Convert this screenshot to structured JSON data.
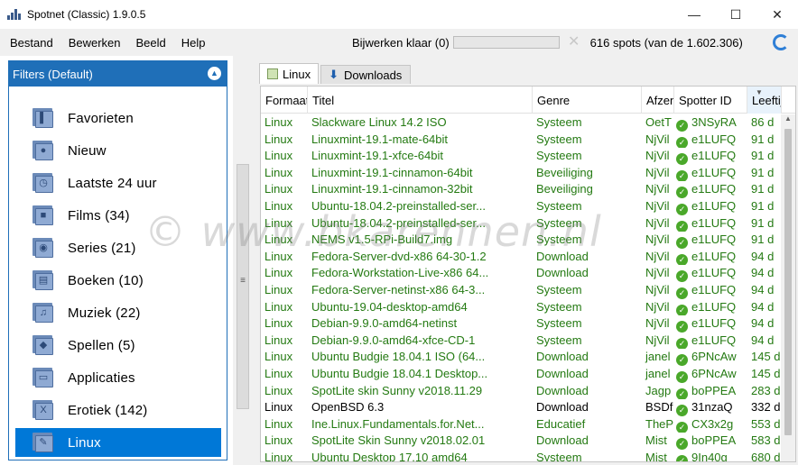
{
  "window": {
    "title": "Spotnet (Classic) 1.9.0.5",
    "controls": {
      "minimize": "—",
      "maximize": "☐",
      "close": "✕"
    }
  },
  "menu": [
    "Bestand",
    "Bewerken",
    "Beeld",
    "Help"
  ],
  "status": {
    "label": "Bijwerken klaar (0)",
    "progress_fraction": 0,
    "spots": "616 spots (van de 1.602.306)"
  },
  "filters": {
    "header": "Filters (Default)",
    "collapse_glyph": "▲",
    "items": [
      {
        "label": "Favorieten",
        "icon": "favorites-icon",
        "glyph": "▌"
      },
      {
        "label": "Nieuw",
        "icon": "new-icon",
        "glyph": "●"
      },
      {
        "label": "Laatste 24 uur",
        "icon": "clock-icon",
        "glyph": "◷"
      },
      {
        "label": "Films (34)",
        "icon": "film-icon",
        "glyph": "■"
      },
      {
        "label": "Series (21)",
        "icon": "series-icon",
        "glyph": "◉"
      },
      {
        "label": "Boeken (10)",
        "icon": "book-icon",
        "glyph": "▤"
      },
      {
        "label": "Muziek (22)",
        "icon": "music-icon",
        "glyph": "♫"
      },
      {
        "label": "Spellen (5)",
        "icon": "gamepad-icon",
        "glyph": "◆"
      },
      {
        "label": "Applicaties",
        "icon": "window-icon",
        "glyph": "▭"
      },
      {
        "label": "Erotiek (142)",
        "icon": "erotic-icon",
        "glyph": "X"
      },
      {
        "label": "Linux",
        "icon": "linux-icon",
        "glyph": "✎",
        "selected": true
      }
    ]
  },
  "tabs": [
    {
      "label": "Linux",
      "active": true
    },
    {
      "label": "Downloads",
      "active": false
    }
  ],
  "columns": [
    "Formaat",
    "Titel",
    "Genre",
    "Afzender",
    "Spotter ID",
    "Leeftijd"
  ],
  "rows": [
    {
      "format": "Linux",
      "title": "Slackware Linux 14.2 ISO",
      "genre": "Systeem",
      "sender": "OetT",
      "spotter": "3NSyRA",
      "age": "86 d"
    },
    {
      "format": "Linux",
      "title": "Linuxmint-19.1-mate-64bit",
      "genre": "Systeem",
      "sender": "NjVil",
      "spotter": "e1LUFQ",
      "age": "91 d"
    },
    {
      "format": "Linux",
      "title": "Linuxmint-19.1-xfce-64bit",
      "genre": "Systeem",
      "sender": "NjVil",
      "spotter": "e1LUFQ",
      "age": "91 d"
    },
    {
      "format": "Linux",
      "title": "Linuxmint-19.1-cinnamon-64bit",
      "genre": "Beveiliging",
      "sender": "NjVil",
      "spotter": "e1LUFQ",
      "age": "91 d"
    },
    {
      "format": "Linux",
      "title": "Linuxmint-19.1-cinnamon-32bit",
      "genre": "Beveiliging",
      "sender": "NjVil",
      "spotter": "e1LUFQ",
      "age": "91 d"
    },
    {
      "format": "Linux",
      "title": "Ubuntu-18.04.2-preinstalled-ser...",
      "genre": "Systeem",
      "sender": "NjVil",
      "spotter": "e1LUFQ",
      "age": "91 d"
    },
    {
      "format": "Linux",
      "title": "Ubuntu-18.04.2-preinstalled-ser...",
      "genre": "Systeem",
      "sender": "NjVil",
      "spotter": "e1LUFQ",
      "age": "91 d"
    },
    {
      "format": "Linux",
      "title": "NEMS v1.5-RPi-Build7.img",
      "genre": "Systeem",
      "sender": "NjVil",
      "spotter": "e1LUFQ",
      "age": "91 d"
    },
    {
      "format": "Linux",
      "title": "Fedora-Server-dvd-x86 64-30-1.2",
      "genre": "Download",
      "sender": "NjVil",
      "spotter": "e1LUFQ",
      "age": "94 d"
    },
    {
      "format": "Linux",
      "title": "Fedora-Workstation-Live-x86 64...",
      "genre": "Download",
      "sender": "NjVil",
      "spotter": "e1LUFQ",
      "age": "94 d"
    },
    {
      "format": "Linux",
      "title": "Fedora-Server-netinst-x86 64-3...",
      "genre": "Systeem",
      "sender": "NjVil",
      "spotter": "e1LUFQ",
      "age": "94 d"
    },
    {
      "format": "Linux",
      "title": "Ubuntu-19.04-desktop-amd64",
      "genre": "Systeem",
      "sender": "NjVil",
      "spotter": "e1LUFQ",
      "age": "94 d"
    },
    {
      "format": "Linux",
      "title": "Debian-9.9.0-amd64-netinst",
      "genre": "Systeem",
      "sender": "NjVil",
      "spotter": "e1LUFQ",
      "age": "94 d"
    },
    {
      "format": "Linux",
      "title": "Debian-9.9.0-amd64-xfce-CD-1",
      "genre": "Systeem",
      "sender": "NjVil",
      "spotter": "e1LUFQ",
      "age": "94 d"
    },
    {
      "format": "Linux",
      "title": "Ubuntu Budgie 18.04.1 ISO (64...",
      "genre": "Download",
      "sender": "janel",
      "spotter": "6PNcAw",
      "age": "145 d"
    },
    {
      "format": "Linux",
      "title": "Ubuntu Budgie 18.04.1 Desktop...",
      "genre": "Download",
      "sender": "janel",
      "spotter": "6PNcAw",
      "age": "145 d"
    },
    {
      "format": "Linux",
      "title": "SpotLite skin Sunny v2018.11.29",
      "genre": "Download",
      "sender": "Jagp",
      "spotter": "boPPEA",
      "age": "283 d"
    },
    {
      "format": "Linux",
      "title": "OpenBSD 6.3",
      "genre": "Download",
      "sender": "BSDf",
      "spotter": "31nzaQ",
      "age": "332 d",
      "black": true
    },
    {
      "format": "Linux",
      "title": "Ine.Linux.Fundamentals.for.Net...",
      "genre": "Educatief",
      "sender": "TheP",
      "spotter": "CX3x2g",
      "age": "553 d"
    },
    {
      "format": "Linux",
      "title": "SpotLite Skin Sunny v2018.02.01",
      "genre": "Download",
      "sender": "Mist",
      "spotter": "boPPEA",
      "age": "583 d"
    },
    {
      "format": "Linux",
      "title": "Ubuntu Desktop 17.10 amd64",
      "genre": "Systeem",
      "sender": "Mist",
      "spotter": "9In40g",
      "age": "680 d"
    }
  ],
  "watermark": "© www.bkarennen.nl"
}
